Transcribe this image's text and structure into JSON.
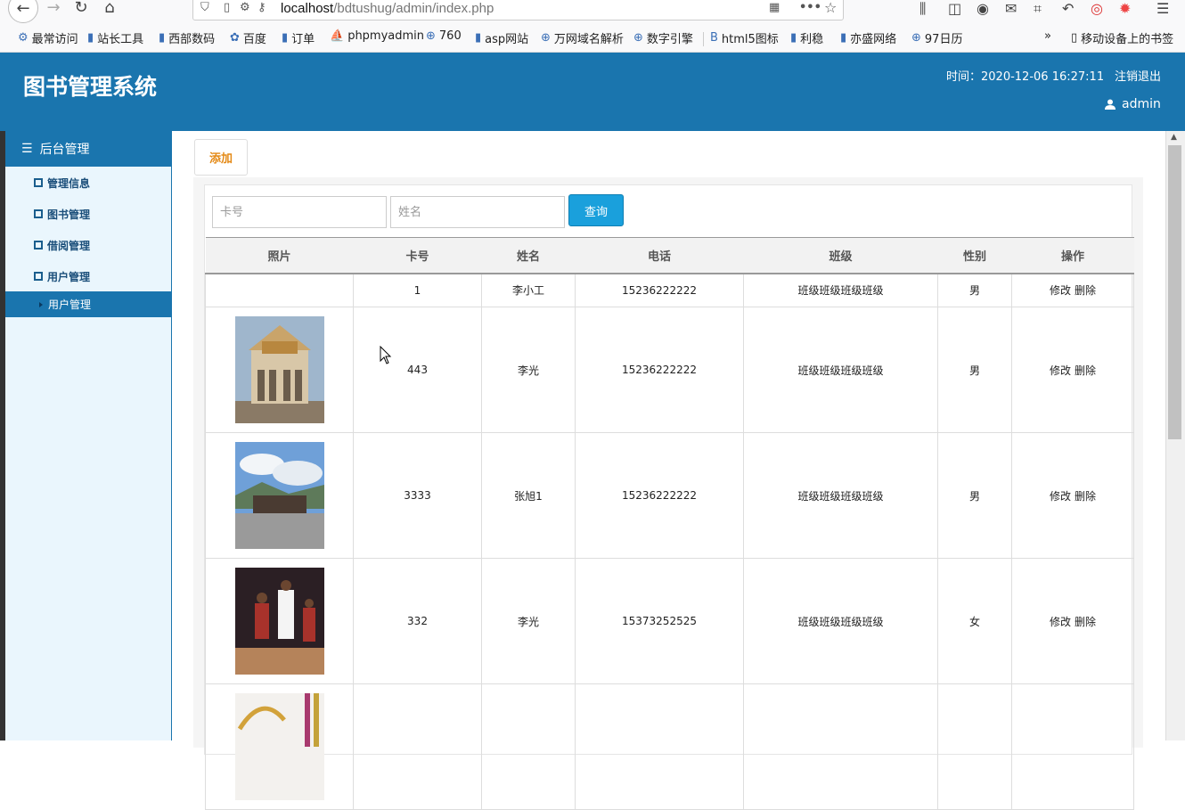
{
  "browser": {
    "url_host": "localhost",
    "url_path": "/bdtushug/admin/index.php",
    "bookmarks": [
      {
        "label": "最常访问",
        "icon": "gear-icon"
      },
      {
        "label": "站长工具",
        "icon": "bookmark-icon"
      },
      {
        "label": "西部数码",
        "icon": "bookmark-icon"
      },
      {
        "label": "百度",
        "icon": "paw-icon"
      },
      {
        "label": "订单",
        "icon": "bookmark-icon"
      },
      {
        "label": "phpmyadmin",
        "icon": "pma-icon"
      },
      {
        "label": "760",
        "icon": "globe-icon"
      },
      {
        "label": "asp网站",
        "icon": "bookmark-icon"
      },
      {
        "label": "万网域名解析",
        "icon": "globe-icon"
      },
      {
        "label": "数字引擎",
        "icon": "globe-icon"
      },
      {
        "label": "html5图标",
        "icon": "b-icon"
      },
      {
        "label": "利稳",
        "icon": "bookmark-icon"
      },
      {
        "label": "亦盛网络",
        "icon": "bookmark-icon"
      },
      {
        "label": "97日历",
        "icon": "globe-icon"
      }
    ],
    "mobile_bookmarks": "移动设备上的书签"
  },
  "header": {
    "title": "图书管理系统",
    "time_label": "时间：",
    "time_value": "2020-12-06 16:27:11",
    "logout": "注销退出",
    "username": "admin"
  },
  "sidebar": {
    "head": "后台管理",
    "items": [
      {
        "label": "管理信息"
      },
      {
        "label": "图书管理"
      },
      {
        "label": "借阅管理"
      },
      {
        "label": "用户管理"
      }
    ],
    "active_sub": "用户管理"
  },
  "toolbar": {
    "add_label": "添加"
  },
  "search": {
    "card_placeholder": "卡号",
    "name_placeholder": "姓名",
    "query_label": "查询"
  },
  "table": {
    "headers": [
      "照片",
      "卡号",
      "姓名",
      "电话",
      "班级",
      "性别",
      "操作"
    ],
    "edit_label": "修改",
    "delete_label": "删除",
    "rows": [
      {
        "card": "1",
        "name": "李小工",
        "phone": "15236222222",
        "class": "班级班级班级班级",
        "gender": "男"
      },
      {
        "card": "443",
        "name": "李光",
        "phone": "15236222222",
        "class": "班级班级班级班级",
        "gender": "男"
      },
      {
        "card": "3333",
        "name": "张旭1",
        "phone": "15236222222",
        "class": "班级班级班级班级",
        "gender": "男"
      },
      {
        "card": "332",
        "name": "李光",
        "phone": "15373252525",
        "class": "班级班级班级班级",
        "gender": "女"
      }
    ]
  }
}
